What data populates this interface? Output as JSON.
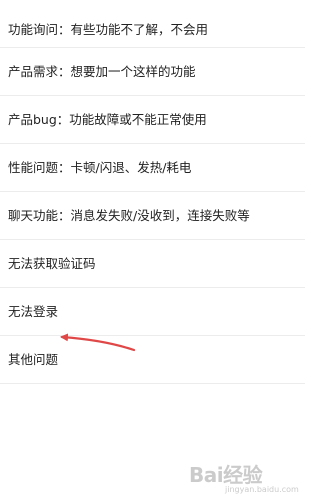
{
  "feedback_options": [
    "功能询问：有些功能不了解，不会用",
    "产品需求：想要加一个这样的功能",
    "产品bug：功能故障或不能正常使用",
    "性能问题：卡顿/闪退、发热/耗电",
    "聊天功能：消息发失败/没收到，连接失败等",
    "无法获取验证码",
    "无法登录",
    "其他问题"
  ],
  "annotation": {
    "arrow_color": "#e04848"
  },
  "watermark": {
    "logo_text": "Bai",
    "logo_suffix": "经验",
    "sub_text": "jingyan.baidu.com"
  }
}
